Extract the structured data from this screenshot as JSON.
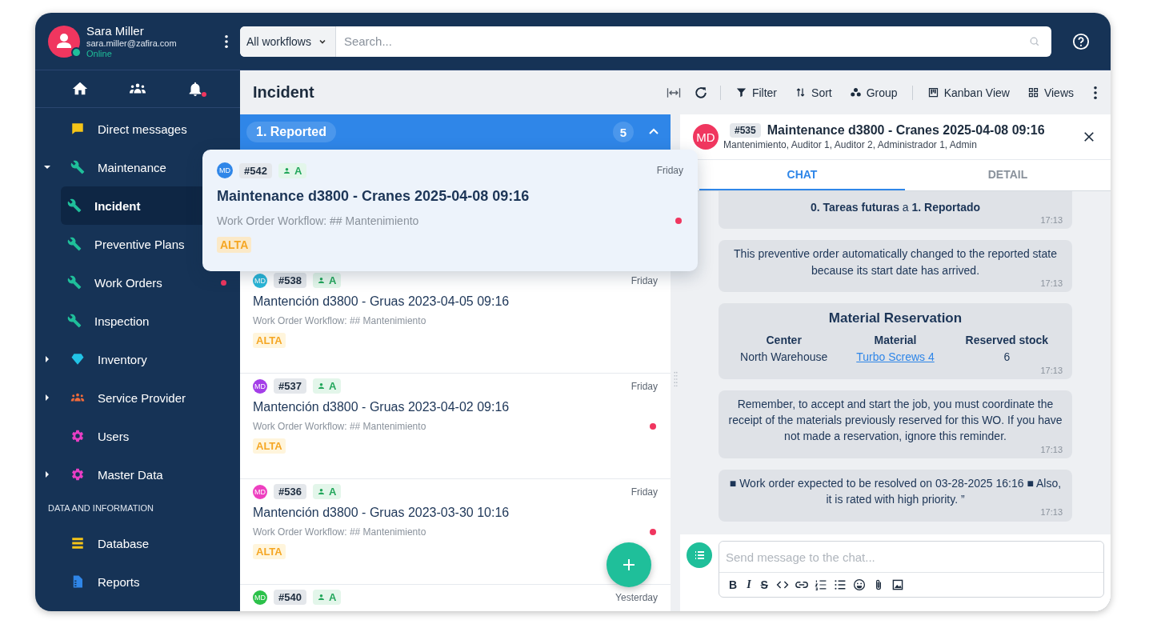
{
  "user": {
    "name": "Sara Miller",
    "email": "sara.miller@zafira.com",
    "status": "Online",
    "online": true
  },
  "search": {
    "filter": "All workflows",
    "placeholder": "Search..."
  },
  "nav": {
    "notifications": true
  },
  "sidebar": {
    "items": [
      {
        "label": "Direct messages",
        "selected": false
      },
      {
        "label": "Maintenance",
        "selected": false,
        "expanded": true,
        "children": [
          {
            "label": "Incident",
            "selected": true,
            "unread": false
          },
          {
            "label": "Preventive Plans",
            "selected": false,
            "unread": false
          },
          {
            "label": "Work Orders",
            "selected": false,
            "unread": true
          },
          {
            "label": "Inspection",
            "selected": false,
            "unread": false
          }
        ]
      },
      {
        "label": "Inventory",
        "selected": false,
        "expanded": false
      },
      {
        "label": "Service Provider",
        "selected": false,
        "expanded": false
      },
      {
        "label": "Users",
        "selected": false
      },
      {
        "label": "Master Data",
        "selected": false,
        "expanded": false
      }
    ],
    "section_title": "DATA AND INFORMATION",
    "section_items": [
      {
        "label": "Database",
        "selected": false
      },
      {
        "label": "Reports",
        "selected": false
      }
    ]
  },
  "toolbar": {
    "title": "Incident",
    "actions": [
      "Filter",
      "Sort",
      "Group",
      "Kanban View",
      "Views"
    ]
  },
  "group": {
    "label": "1. Reported",
    "count": "5",
    "expanded": true
  },
  "dragged_card": {
    "avatar": "MD",
    "color": "#2f86e8",
    "id": "#542",
    "badge": "A",
    "day": "Friday",
    "title": "Maintenance d3800 - Cranes 2025-04-08 09:16",
    "workflow": "Work Order Workflow: ## Mantenimiento",
    "priority": "ALTA",
    "unread": true
  },
  "cards": [
    {
      "avatar": "MD",
      "color": "#29b6d8",
      "id": "#538",
      "badge": "A",
      "day": "Friday",
      "title": "Mantención d3800 - Gruas 2023-04-05 09:16",
      "workflow": "Work Order Workflow: ## Mantenimiento",
      "priority": "ALTA",
      "unread": false
    },
    {
      "avatar": "MD",
      "color": "#a43ee8",
      "id": "#537",
      "badge": "A",
      "day": "Friday",
      "title": "Mantención d3800 - Gruas 2023-04-02 09:16",
      "workflow": "Work Order Workflow: ## Mantenimiento",
      "priority": "ALTA",
      "unread": true
    },
    {
      "avatar": "MD",
      "color": "#ee3fc0",
      "id": "#536",
      "badge": "A",
      "day": "Friday",
      "title": "Mantención d3800 - Gruas 2023-03-30 10:16",
      "workflow": "Work Order Workflow: ## Mantenimiento",
      "priority": "ALTA",
      "unread": true
    },
    {
      "avatar": "MD",
      "color": "#2cc14a",
      "id": "#540",
      "badge": "A",
      "day": "Yesterday"
    }
  ],
  "detail": {
    "avatar": "MD",
    "id": "#535",
    "title": "Maintenance d3800 - Cranes 2025-04-08 09:16",
    "members": "Mantenimiento, Auditor 1, Auditor 2, Administrador 1, Admin",
    "tabs": [
      {
        "label": "CHAT",
        "selected": true
      },
      {
        "label": "DETAIL",
        "selected": false
      }
    ],
    "messages": [
      {
        "kind": "text",
        "text": "**0. Tareas futuras** a **1. Reportado**",
        "time": "17:13"
      },
      {
        "kind": "text",
        "text": "This preventive order automatically changed to the reported state because its start date has arrived.",
        "time": "17:13"
      },
      {
        "kind": "table",
        "title": "Material Reservation",
        "columns": [
          "Center",
          "Material",
          "Reserved stock"
        ],
        "row": [
          {
            "text": "North Warehouse",
            "link": false
          },
          {
            "text": "Turbo Screws 4",
            "link": true
          },
          {
            "text": "6",
            "link": false
          }
        ],
        "time": "17:13"
      },
      {
        "kind": "text",
        "text": "Remember, to accept and start the job, you must coordinate the receipt of the materials previously reserved for this WO. If you have not made a reservation, ignore this reminder.",
        "time": "17:13"
      },
      {
        "kind": "text",
        "text": "■ Work order expected to be resolved on 03-28-2025 16:16 ■ Also, it is rated with high priority. ”",
        "time": "17:13"
      }
    ],
    "composer": {
      "placeholder": "Send message to the chat...",
      "format": [
        {
          "kind": "bold",
          "label": "B"
        },
        {
          "kind": "italic",
          "label": "I"
        },
        {
          "kind": "strike",
          "label": "S"
        }
      ]
    }
  }
}
